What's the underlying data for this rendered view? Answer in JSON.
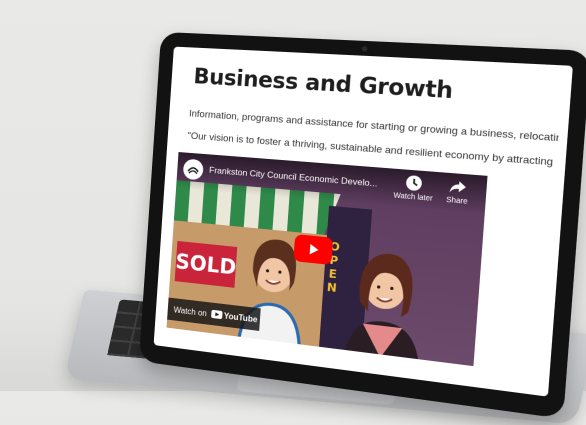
{
  "page": {
    "title": "Business and Growth",
    "intro": "Information, programs and assistance for starting or growing a business, relocating",
    "quote": "\"Our vision is to foster a thriving, sustainable and resilient economy by attracting"
  },
  "video": {
    "title": "Frankston City Council Economic Develo...",
    "watch_later_label": "Watch later",
    "share_label": "Share",
    "watch_on_label": "Watch on",
    "platform_label": "YouTube",
    "scene": {
      "sold_sign": "SOLD",
      "open_sign": "OPEN"
    }
  },
  "colors": {
    "play_button": "#ff0000",
    "awning_green": "#2f8a4a",
    "sold_red": "#c9243a"
  },
  "icons": {
    "watch_later": "clock-icon",
    "share": "share-arrow-icon",
    "play": "play-icon",
    "channel": "channel-avatar-icon"
  }
}
